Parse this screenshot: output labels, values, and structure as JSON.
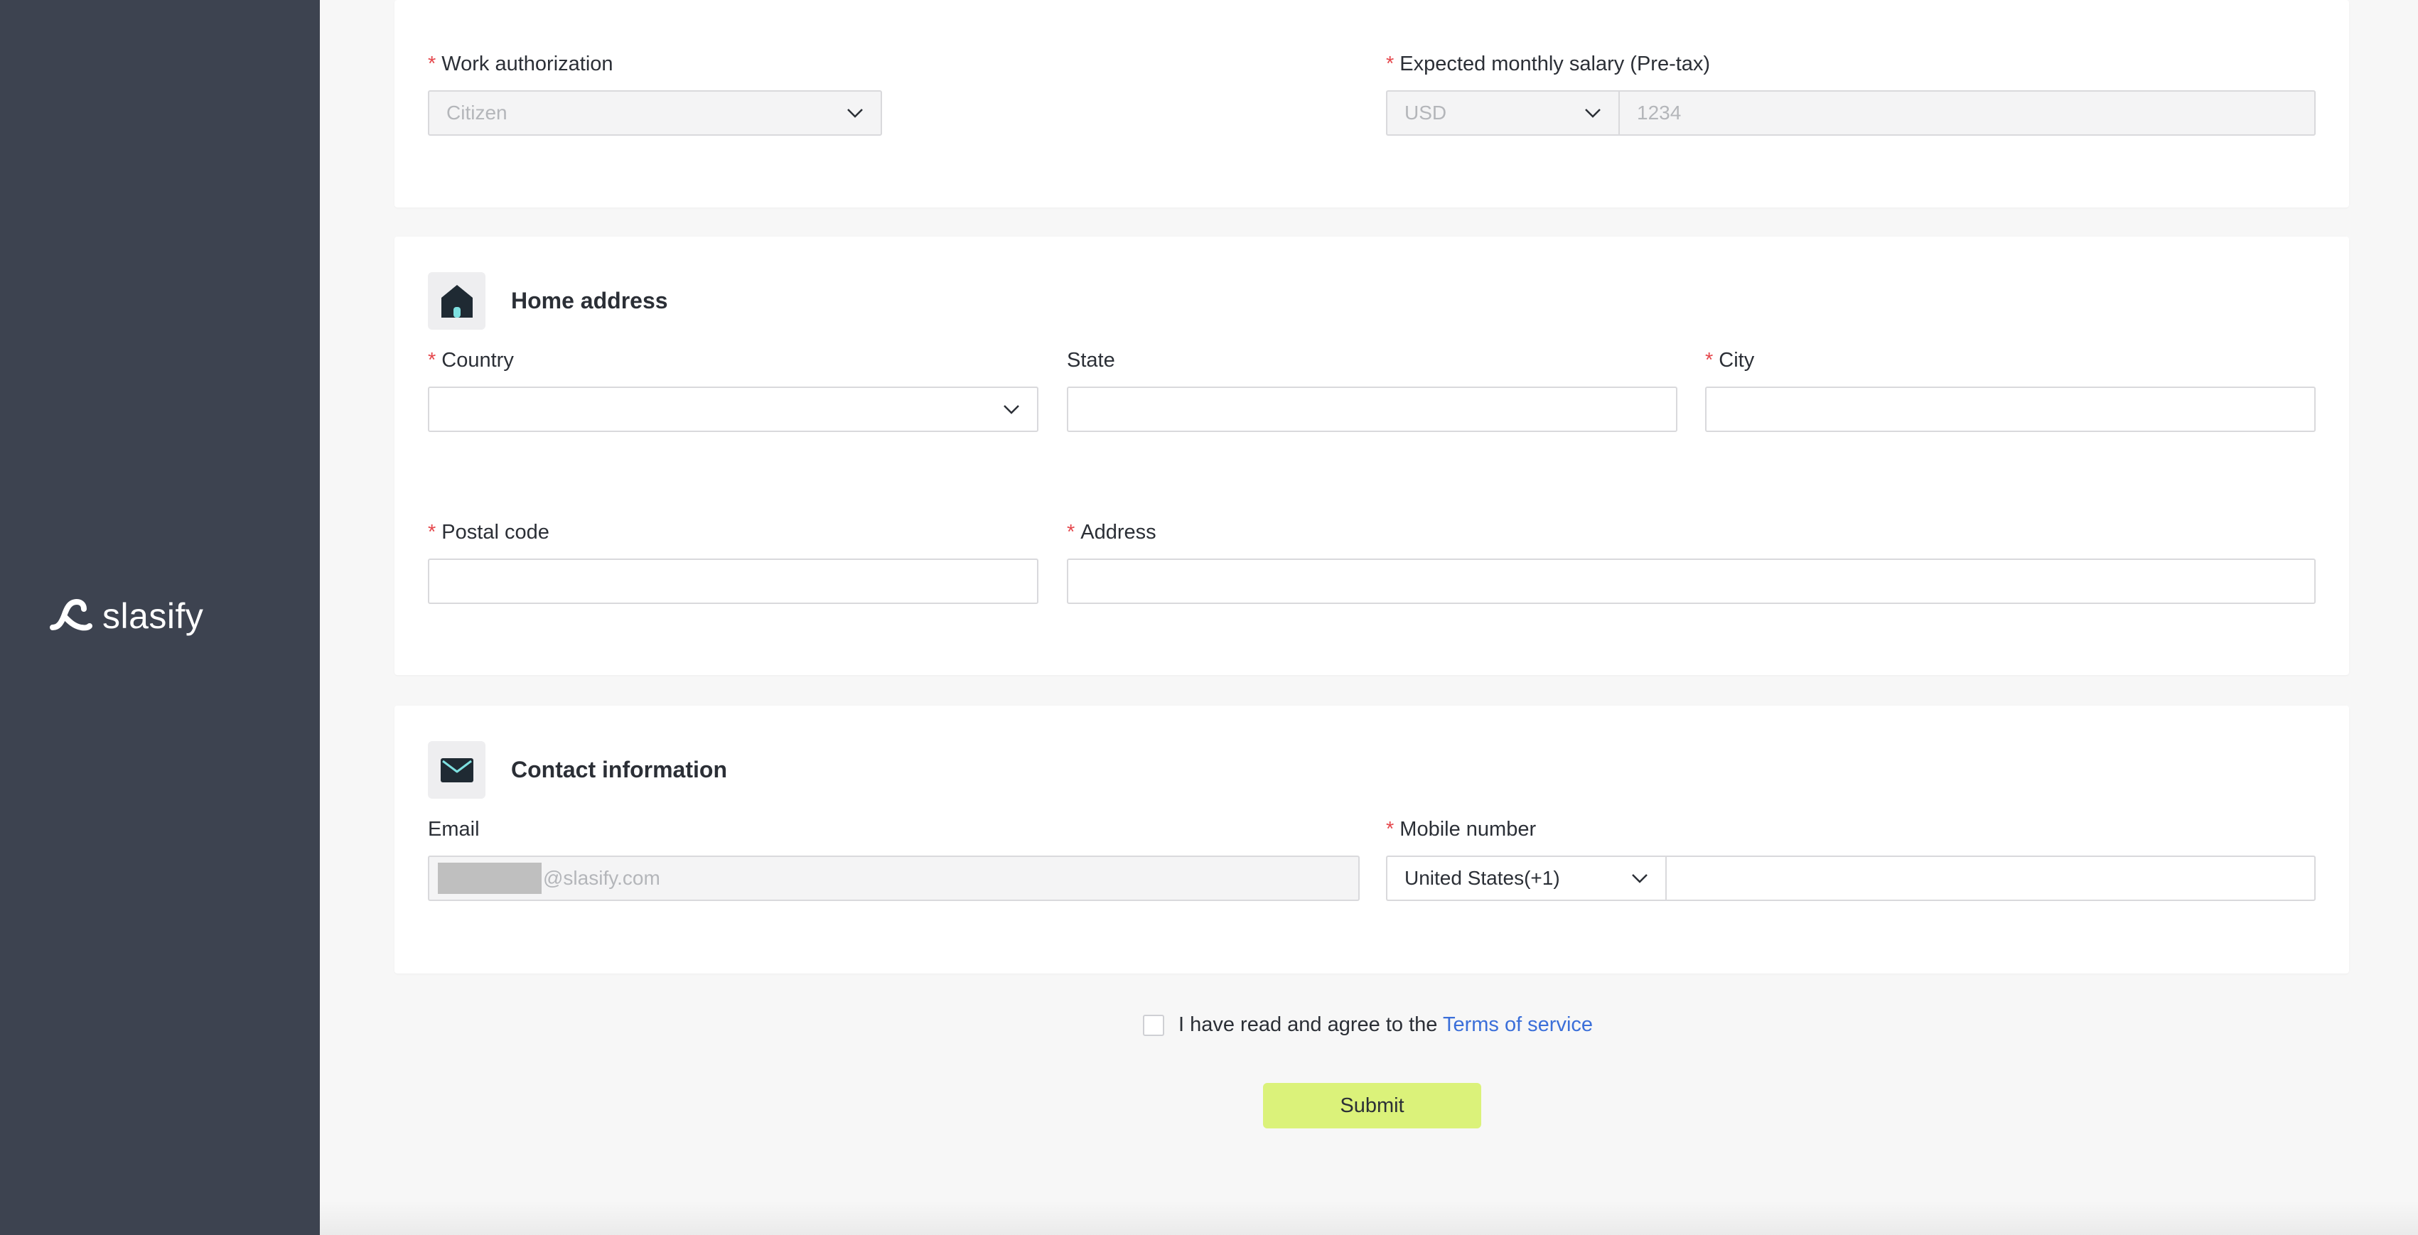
{
  "brand": {
    "name": "slasify"
  },
  "work": {
    "work_authorization": {
      "label": "Work authorization",
      "value": "Citizen"
    },
    "salary": {
      "label": "Expected monthly salary (Pre-tax)",
      "currency": "USD",
      "amount_placeholder": "1234"
    }
  },
  "home": {
    "title": "Home address",
    "country": {
      "label": "Country",
      "value": ""
    },
    "state": {
      "label": "State",
      "value": ""
    },
    "city": {
      "label": "City",
      "value": ""
    },
    "postal": {
      "label": "Postal code",
      "value": ""
    },
    "address": {
      "label": "Address",
      "value": ""
    }
  },
  "contact": {
    "title": "Contact information",
    "email": {
      "label": "Email",
      "value": "@slasify.com"
    },
    "mobile": {
      "label": "Mobile number",
      "country_code": "United States(+1)",
      "value": ""
    }
  },
  "terms": {
    "text": "I have read and agree to the",
    "link": "Terms of service"
  },
  "submit_label": "Submit",
  "required_mark": "*",
  "colors": {
    "sidebar": "#3d4350",
    "accent": "#dbf27a",
    "required": "#e5484d",
    "link": "#3b6fd9",
    "icon_accent": "#7ee0e0"
  }
}
